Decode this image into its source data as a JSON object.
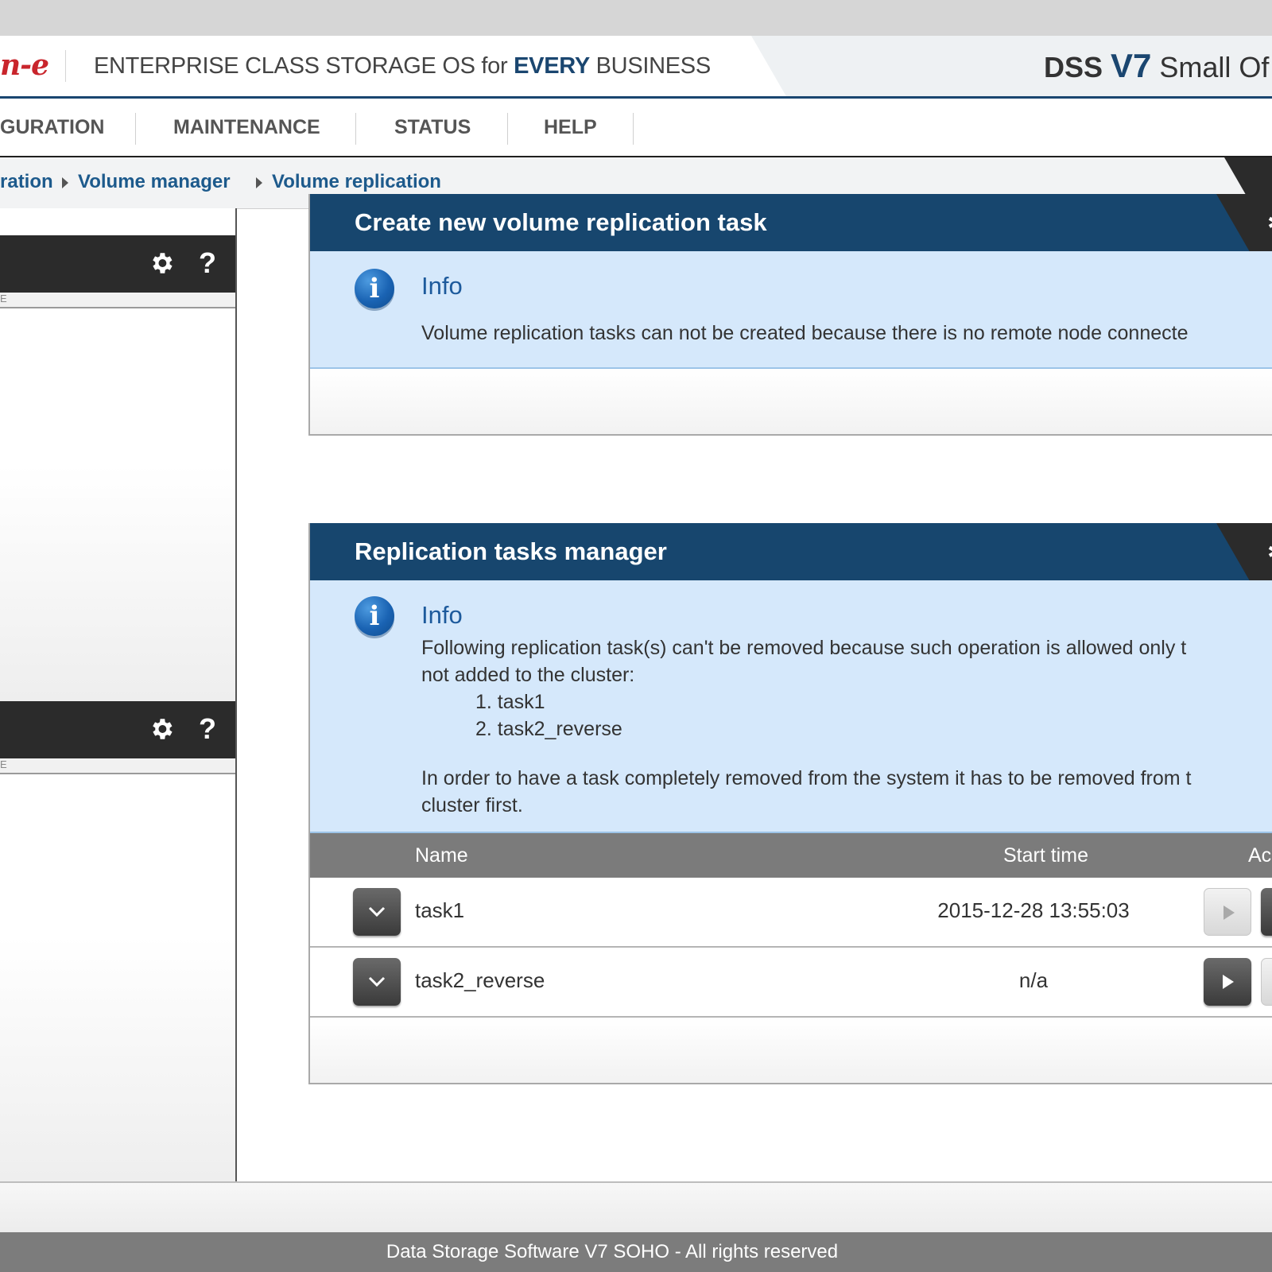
{
  "header": {
    "logo_fragment": "n-e",
    "tagline_part1": "ENTERPRISE CLASS STORAGE OS for ",
    "tagline_highlight": "EVERY",
    "tagline_part2": " BUSINESS",
    "product_prefix": "DSS ",
    "product_version": "V7",
    "product_edition": " Small Of"
  },
  "nav": {
    "items": [
      "GURATION",
      "MAINTENANCE",
      "STATUS",
      "HELP"
    ]
  },
  "breadcrumb": {
    "items": [
      "ration",
      "Volume manager",
      "Volume replication"
    ]
  },
  "left_panels": {
    "help_symbol": "?",
    "strip_fragment": "E"
  },
  "create_panel": {
    "title": "Create new volume replication task",
    "info_title": "Info",
    "info_text": "Volume replication tasks can not be created because there is no remote node connecte"
  },
  "manager_panel": {
    "title": "Replication tasks manager",
    "info_title": "Info",
    "info_line1": "Following replication task(s) can't be removed because such operation is allowed only t",
    "info_line2": "not added to the cluster:",
    "info_list": [
      "1. task1",
      "2. task2_reverse"
    ],
    "info_line3": "In order to have a task completely removed from the system it has to be removed from t",
    "info_line4": "cluster first.",
    "table": {
      "headers": {
        "name": "Name",
        "start_time": "Start time",
        "actions": "Ac"
      },
      "rows": [
        {
          "name": "task1",
          "start_time": "2015-12-28 13:55:03",
          "start_enabled": false
        },
        {
          "name": "task2_reverse",
          "start_time": "n/a",
          "start_enabled": true
        }
      ]
    }
  },
  "footer": {
    "text": "Data Storage Software V7 SOHO - All rights reserved"
  },
  "colors": {
    "brand_blue": "#17466e",
    "link_blue": "#1d5a8c",
    "info_bg": "#d5e8fb",
    "dark_bar": "#2b2b2b",
    "table_header": "#7b7b7b"
  }
}
